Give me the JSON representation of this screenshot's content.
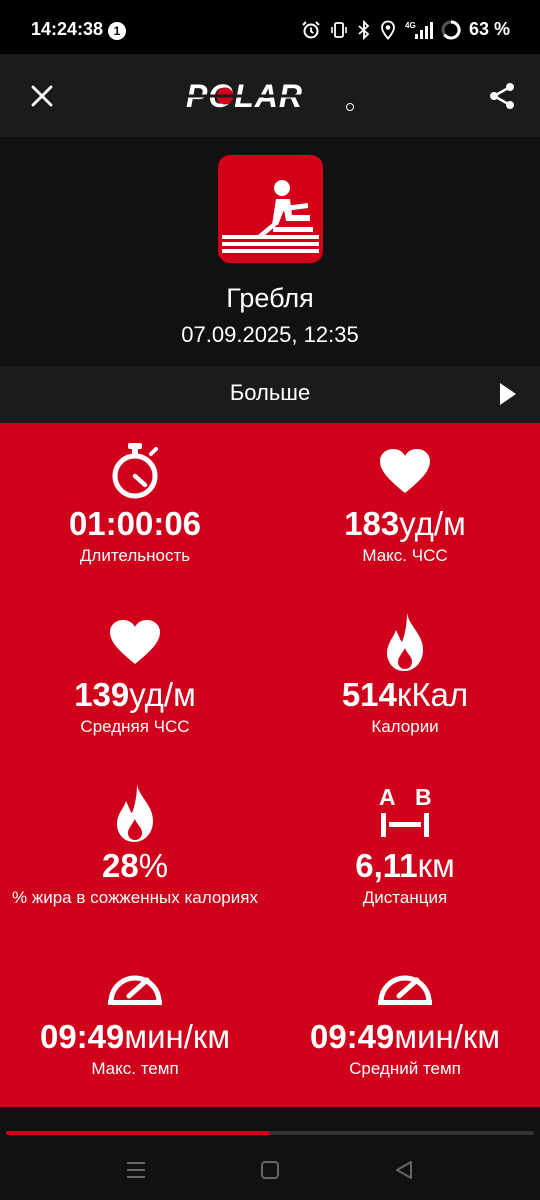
{
  "status_bar": {
    "time": "14:24:38",
    "notification_count": "1",
    "battery": "63 %",
    "network": "4G"
  },
  "app_bar": {
    "logo_text": "POLAR"
  },
  "header": {
    "sport_name": "Гребля",
    "date": "07.09.2025, 12:35"
  },
  "more": {
    "label": "Больше"
  },
  "stats": [
    {
      "value": "01:00:06",
      "unit": "",
      "label": "Длительность",
      "icon": "stopwatch-icon"
    },
    {
      "value": "183",
      "unit": "уд/м",
      "label": "Макс. ЧСС",
      "icon": "heart-icon"
    },
    {
      "value": "139",
      "unit": "уд/м",
      "label": "Средняя ЧСС",
      "icon": "heart-icon"
    },
    {
      "value": "514",
      "unit": "кКал",
      "label": "Калории",
      "icon": "flame-icon"
    },
    {
      "value": "28",
      "unit": "%",
      "label": "% жира в сожженных калориях",
      "icon": "flame-icon"
    },
    {
      "value": "6,11",
      "unit": "км",
      "label": "Дистанция",
      "icon": "distance-ab-icon",
      "icon_letters": [
        "A",
        "B"
      ]
    },
    {
      "value": "09:49",
      "unit": "мин/км",
      "label": "Макс. темп",
      "icon": "speedometer-icon"
    },
    {
      "value": "09:49",
      "unit": "мин/км",
      "label": "Средний темп",
      "icon": "speedometer-icon"
    }
  ],
  "page_progress": 0.5,
  "colors": {
    "accent_red": "#d0021b",
    "app_bar": "#1b1b1b",
    "header_bg": "#111111"
  }
}
